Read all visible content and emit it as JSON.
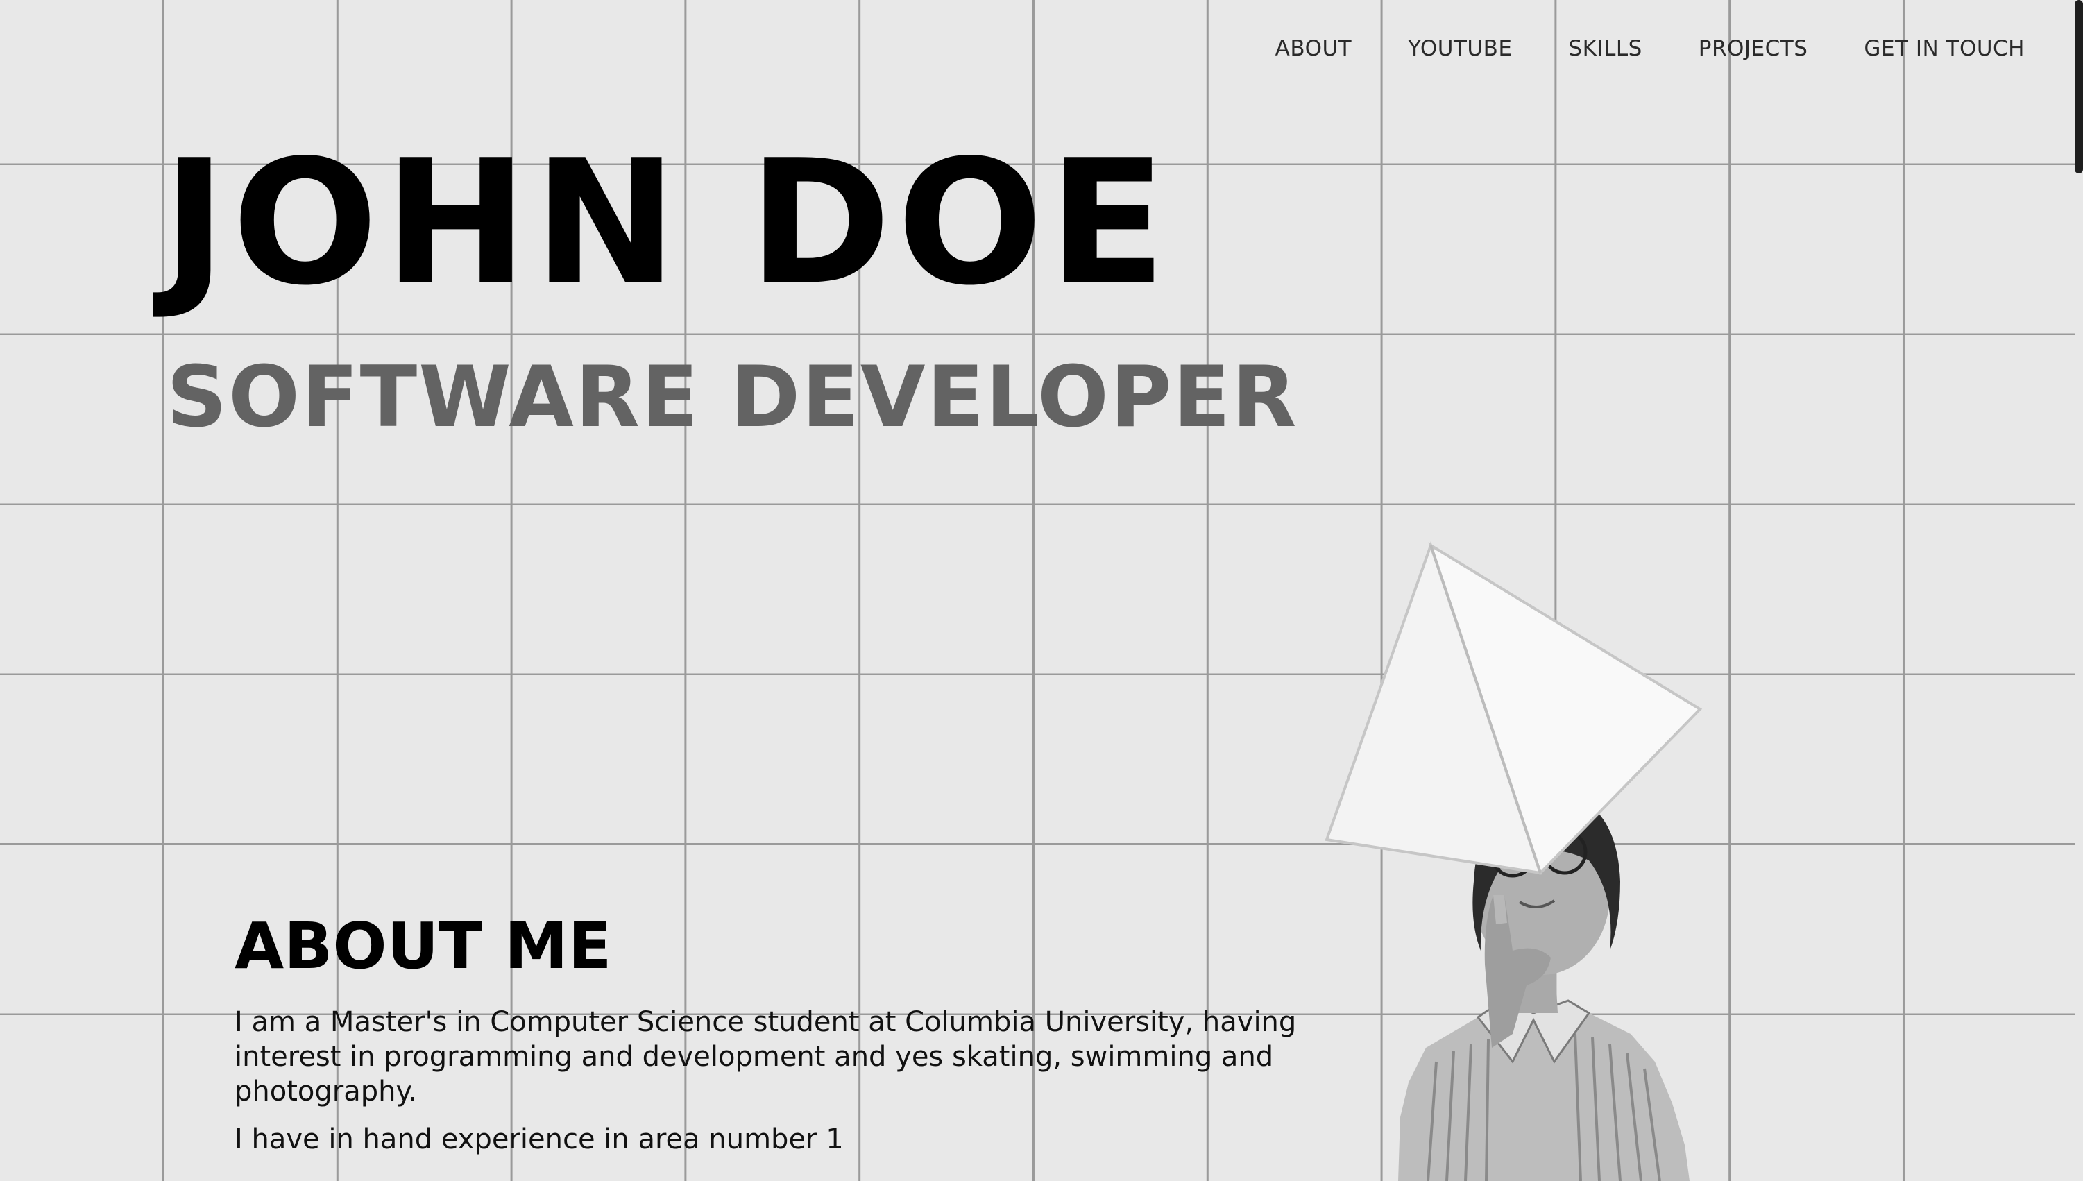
{
  "nav": {
    "items": [
      {
        "label": "ABOUT"
      },
      {
        "label": "YOUTUBE"
      },
      {
        "label": "SKILLS"
      },
      {
        "label": "PROJECTS"
      },
      {
        "label": "GET IN TOUCH"
      }
    ]
  },
  "hero": {
    "name": "JOHN DOE",
    "role": "SOFTWARE DEVELOPER"
  },
  "about": {
    "heading": "ABOUT ME",
    "paragraphs": [
      "I am a Master's in Computer Science student at Columbia University, having interest in programming and development and yes skating, swimming and photography.",
      "I have in hand experience in area number 1"
    ]
  },
  "colors": {
    "background": "#e8e8e8",
    "grid_lines": "#9a9a9a",
    "name_text": "#000000",
    "role_text": "#636363"
  },
  "icons": {
    "hero_graphic": "pyramid-icon",
    "portrait": "person-portrait"
  }
}
